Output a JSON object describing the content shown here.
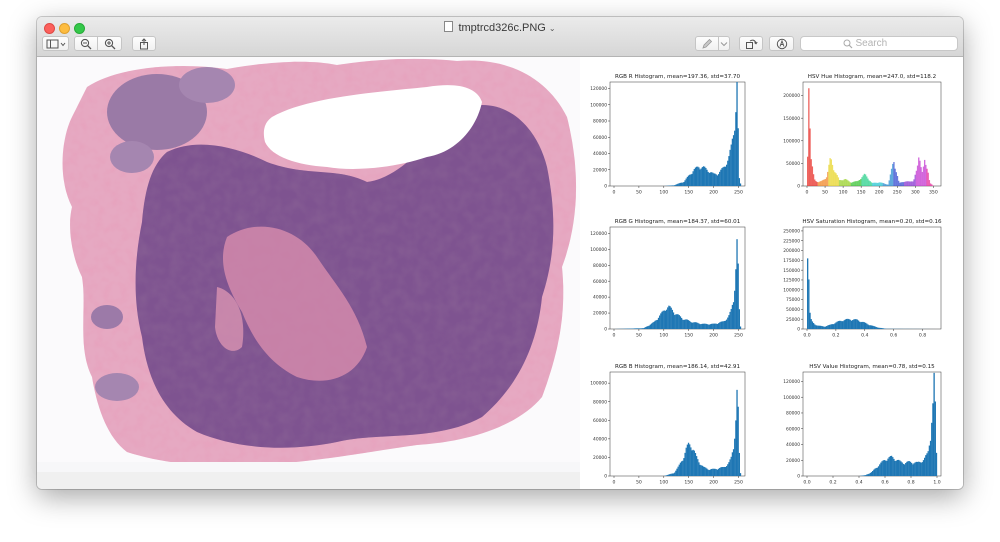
{
  "window": {
    "title": "tmptrcd326c.PNG",
    "search_placeholder": "Search"
  },
  "colors": {
    "histogram_blue": "#1f77b4",
    "tissue_purple": "#7a4d8a",
    "stroma_pink": "#d98aa8"
  },
  "icons": {
    "sidebar": "sidebar-icon",
    "zoom_out": "zoom-out-icon",
    "zoom_in": "zoom-in-icon",
    "share": "share-icon",
    "markup": "pen-icon",
    "rotate": "rotate-icon",
    "annotate": "markup-circle-icon",
    "search": "search-icon"
  },
  "chart_data": [
    {
      "type": "bar",
      "title": "RGB R Histogram, mean=197.36, std=37.70",
      "xticks": [
        "0",
        "50",
        "100",
        "150",
        "200",
        "250"
      ],
      "yticks": [
        "0",
        "20000",
        "40000",
        "60000",
        "80000",
        "100000",
        "120000"
      ],
      "xlim": [
        0,
        255
      ],
      "ylim": [
        0,
        128000
      ],
      "x": [
        0,
        100,
        120,
        140,
        150,
        160,
        170,
        180,
        190,
        200,
        210,
        220,
        230,
        235,
        240,
        243,
        245,
        247,
        249,
        251,
        255
      ],
      "y": [
        0,
        0,
        800,
        5000,
        12000,
        19000,
        23000,
        22000,
        18000,
        14000,
        15000,
        22000,
        32000,
        45000,
        65000,
        80000,
        95000,
        125000,
        70000,
        10000,
        0
      ]
    },
    {
      "type": "bar",
      "title": "HSV Hue Histogram, mean=247.0, std=118.2",
      "xticks": [
        "0",
        "50",
        "100",
        "150",
        "200",
        "250",
        "300",
        "350"
      ],
      "yticks": [
        "0",
        "50000",
        "100000",
        "150000",
        "200000"
      ],
      "xlim": [
        0,
        360
      ],
      "ylim": [
        0,
        230000
      ],
      "x": [
        0,
        5,
        10,
        20,
        30,
        40,
        55,
        65,
        75,
        90,
        105,
        120,
        140,
        160,
        180,
        200,
        225,
        240,
        255,
        270,
        285,
        295,
        300,
        305,
        310,
        315,
        320,
        325,
        330,
        335,
        340,
        350
      ],
      "y": [
        0,
        225000,
        60000,
        15000,
        8000,
        10000,
        20000,
        60000,
        35000,
        12000,
        15000,
        8000,
        10000,
        25000,
        6000,
        8000,
        3000,
        55000,
        6000,
        10000,
        9000,
        12000,
        25000,
        35000,
        62000,
        48000,
        30000,
        55000,
        38000,
        30000,
        8000,
        0
      ]
    },
    {
      "type": "bar",
      "title": "RGB G Histogram, mean=184.37, std=60.01",
      "xticks": [
        "0",
        "50",
        "100",
        "150",
        "200",
        "250"
      ],
      "yticks": [
        "0",
        "20000",
        "40000",
        "60000",
        "80000",
        "100000",
        "120000"
      ],
      "xlim": [
        0,
        255
      ],
      "ylim": [
        0,
        128000
      ],
      "x": [
        0,
        60,
        80,
        90,
        100,
        105,
        110,
        115,
        125,
        140,
        160,
        180,
        200,
        220,
        230,
        235,
        240,
        243,
        246,
        248,
        250,
        253,
        255
      ],
      "y": [
        0,
        1000,
        8000,
        15000,
        22000,
        26000,
        27000,
        24000,
        18000,
        12000,
        8000,
        6000,
        6000,
        9000,
        15000,
        22000,
        35000,
        60000,
        90000,
        125000,
        40000,
        5000,
        0
      ]
    },
    {
      "type": "bar",
      "title": "HSV Saturation Histogram, mean=0.20, std=0.16",
      "xticks": [
        "0.0",
        "0.2",
        "0.4",
        "0.6",
        "0.8"
      ],
      "yticks": [
        "0",
        "25000",
        "50000",
        "75000",
        "100000",
        "125000",
        "150000",
        "175000",
        "200000",
        "225000",
        "250000"
      ],
      "xlim": [
        0,
        0.9
      ],
      "ylim": [
        0,
        260000
      ],
      "x": [
        0,
        0.005,
        0.01,
        0.015,
        0.02,
        0.03,
        0.05,
        0.08,
        0.12,
        0.16,
        0.2,
        0.25,
        0.3,
        0.35,
        0.4,
        0.45,
        0.5,
        0.55,
        0.9
      ],
      "y": [
        0,
        250000,
        170000,
        80000,
        40000,
        20000,
        12000,
        8000,
        6000,
        10000,
        16000,
        22000,
        24000,
        22000,
        15000,
        8000,
        3000,
        500,
        0
      ]
    },
    {
      "type": "bar",
      "title": "RGB B Histogram, mean=186.14, std=42.91",
      "xticks": [
        "0",
        "50",
        "100",
        "150",
        "200",
        "250"
      ],
      "yticks": [
        "0",
        "20000",
        "40000",
        "60000",
        "80000",
        "100000"
      ],
      "xlim": [
        0,
        255
      ],
      "ylim": [
        0,
        112000
      ],
      "x": [
        0,
        100,
        120,
        130,
        140,
        145,
        150,
        155,
        160,
        165,
        170,
        180,
        190,
        200,
        210,
        220,
        230,
        235,
        240,
        243,
        246,
        248,
        250,
        253,
        255
      ],
      "y": [
        0,
        0,
        3000,
        10000,
        20000,
        28000,
        33000,
        32000,
        27000,
        20000,
        15000,
        9000,
        7000,
        7000,
        8000,
        9000,
        13000,
        18000,
        30000,
        50000,
        70000,
        108000,
        40000,
        5000,
        0
      ]
    },
    {
      "type": "bar",
      "title": "HSV Value Histogram, mean=0.78, std=0.15",
      "xticks": [
        "0.0",
        "0.2",
        "0.4",
        "0.6",
        "0.8",
        "1.0"
      ],
      "yticks": [
        "0",
        "20000",
        "40000",
        "60000",
        "80000",
        "100000",
        "120000"
      ],
      "xlim": [
        0,
        1.0
      ],
      "ylim": [
        0,
        132000
      ],
      "x": [
        0,
        0.4,
        0.45,
        0.5,
        0.55,
        0.6,
        0.62,
        0.65,
        0.68,
        0.7,
        0.72,
        0.75,
        0.78,
        0.8,
        0.85,
        0.9,
        0.93,
        0.95,
        0.97,
        0.98,
        0.99,
        1.0
      ],
      "y": [
        0,
        0,
        1000,
        5000,
        13000,
        20000,
        22000,
        23000,
        21000,
        19000,
        17000,
        16000,
        17000,
        17000,
        16000,
        20000,
        28000,
        50000,
        90000,
        128000,
        60000,
        0
      ]
    }
  ]
}
